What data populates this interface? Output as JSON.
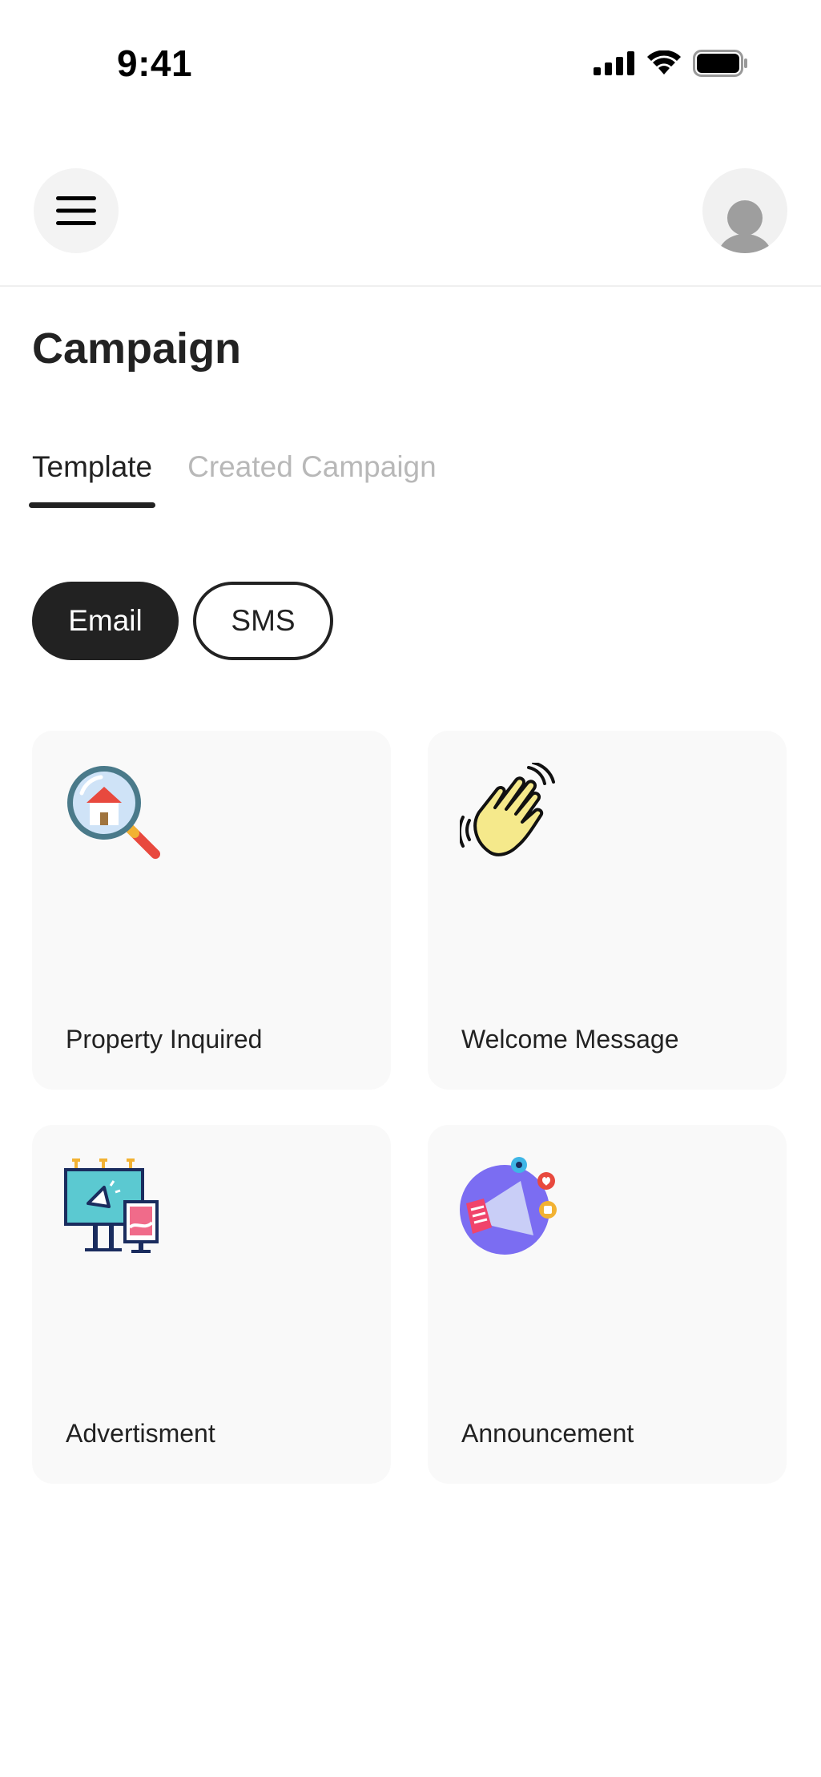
{
  "status_bar": {
    "time": "9:41"
  },
  "header": {
    "menu_icon": "hamburger-menu-icon",
    "avatar_icon": "user-avatar-icon"
  },
  "page": {
    "title": "Campaign"
  },
  "tabs": [
    {
      "label": "Template",
      "active": true
    },
    {
      "label": "Created Campaign",
      "active": false
    }
  ],
  "channels": [
    {
      "label": "Email",
      "selected": true
    },
    {
      "label": "SMS",
      "selected": false
    }
  ],
  "templates": [
    {
      "label": "Property Inquired",
      "icon": "house-search-icon"
    },
    {
      "label": "Welcome Message",
      "icon": "waving-hand-icon"
    },
    {
      "label": "Advertisment",
      "icon": "billboard-advertising-icon"
    },
    {
      "label": "Announcement",
      "icon": "megaphone-icon"
    }
  ],
  "colors": {
    "primary": "#222222",
    "inactive_tab": "#b8b8b8",
    "card_background": "#f9f9f9",
    "icon_button_background": "#f3f3f3"
  }
}
